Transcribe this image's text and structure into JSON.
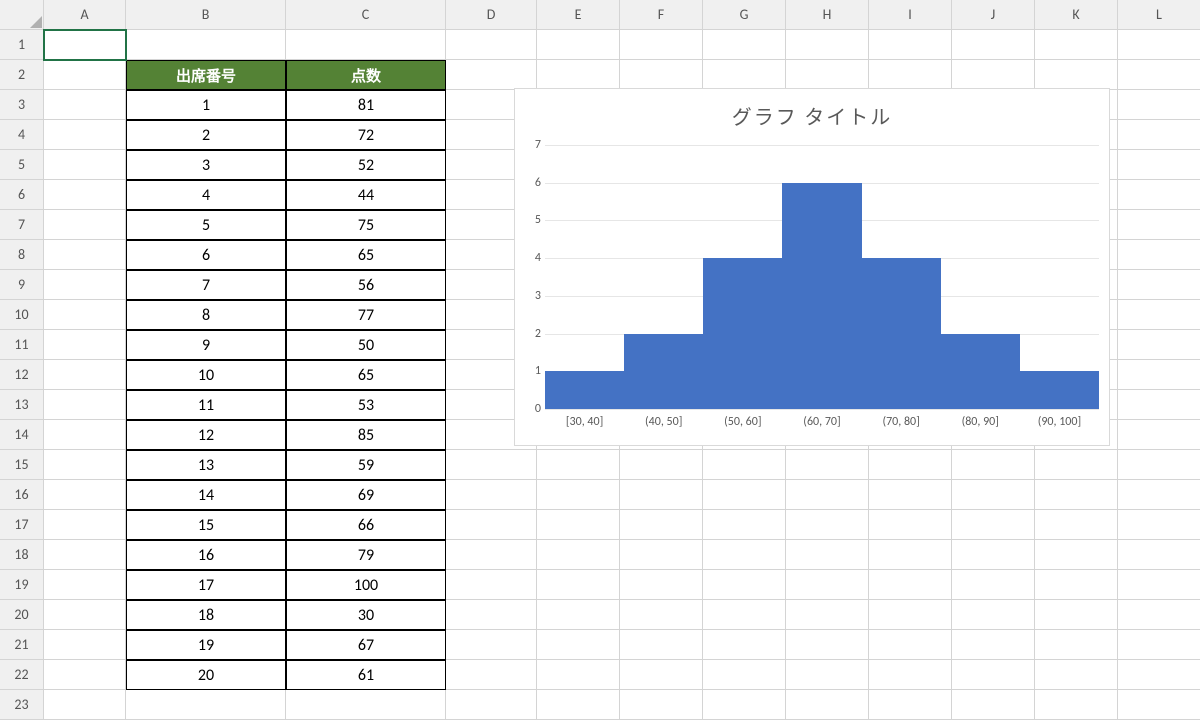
{
  "columns": [
    "A",
    "B",
    "C",
    "D",
    "E",
    "F",
    "G",
    "H",
    "I",
    "J",
    "K",
    "L"
  ],
  "row_count": 23,
  "selected_cell": "A1",
  "table": {
    "header_row": 2,
    "headers": {
      "B": "出席番号",
      "C": "点数"
    },
    "rows": [
      {
        "id": 1,
        "score": 81
      },
      {
        "id": 2,
        "score": 72
      },
      {
        "id": 3,
        "score": 52
      },
      {
        "id": 4,
        "score": 44
      },
      {
        "id": 5,
        "score": 75
      },
      {
        "id": 6,
        "score": 65
      },
      {
        "id": 7,
        "score": 56
      },
      {
        "id": 8,
        "score": 77
      },
      {
        "id": 9,
        "score": 50
      },
      {
        "id": 10,
        "score": 65
      },
      {
        "id": 11,
        "score": 53
      },
      {
        "id": 12,
        "score": 85
      },
      {
        "id": 13,
        "score": 59
      },
      {
        "id": 14,
        "score": 69
      },
      {
        "id": 15,
        "score": 66
      },
      {
        "id": 16,
        "score": 79
      },
      {
        "id": 17,
        "score": 100
      },
      {
        "id": 18,
        "score": 30
      },
      {
        "id": 19,
        "score": 67
      },
      {
        "id": 20,
        "score": 61
      }
    ]
  },
  "chart_data": {
    "type": "bar",
    "title": "グラフ タイトル",
    "categories": [
      "[30, 40]",
      "(40, 50]",
      "(50, 60]",
      "(60, 70]",
      "(70, 80]",
      "(80, 90]",
      "(90, 100]"
    ],
    "values": [
      1,
      2,
      4,
      6,
      4,
      2,
      1
    ],
    "ylim": [
      0,
      7
    ],
    "ytick": [
      0,
      1,
      2,
      3,
      4,
      5,
      6,
      7
    ],
    "bar_color": "#4472C4"
  }
}
